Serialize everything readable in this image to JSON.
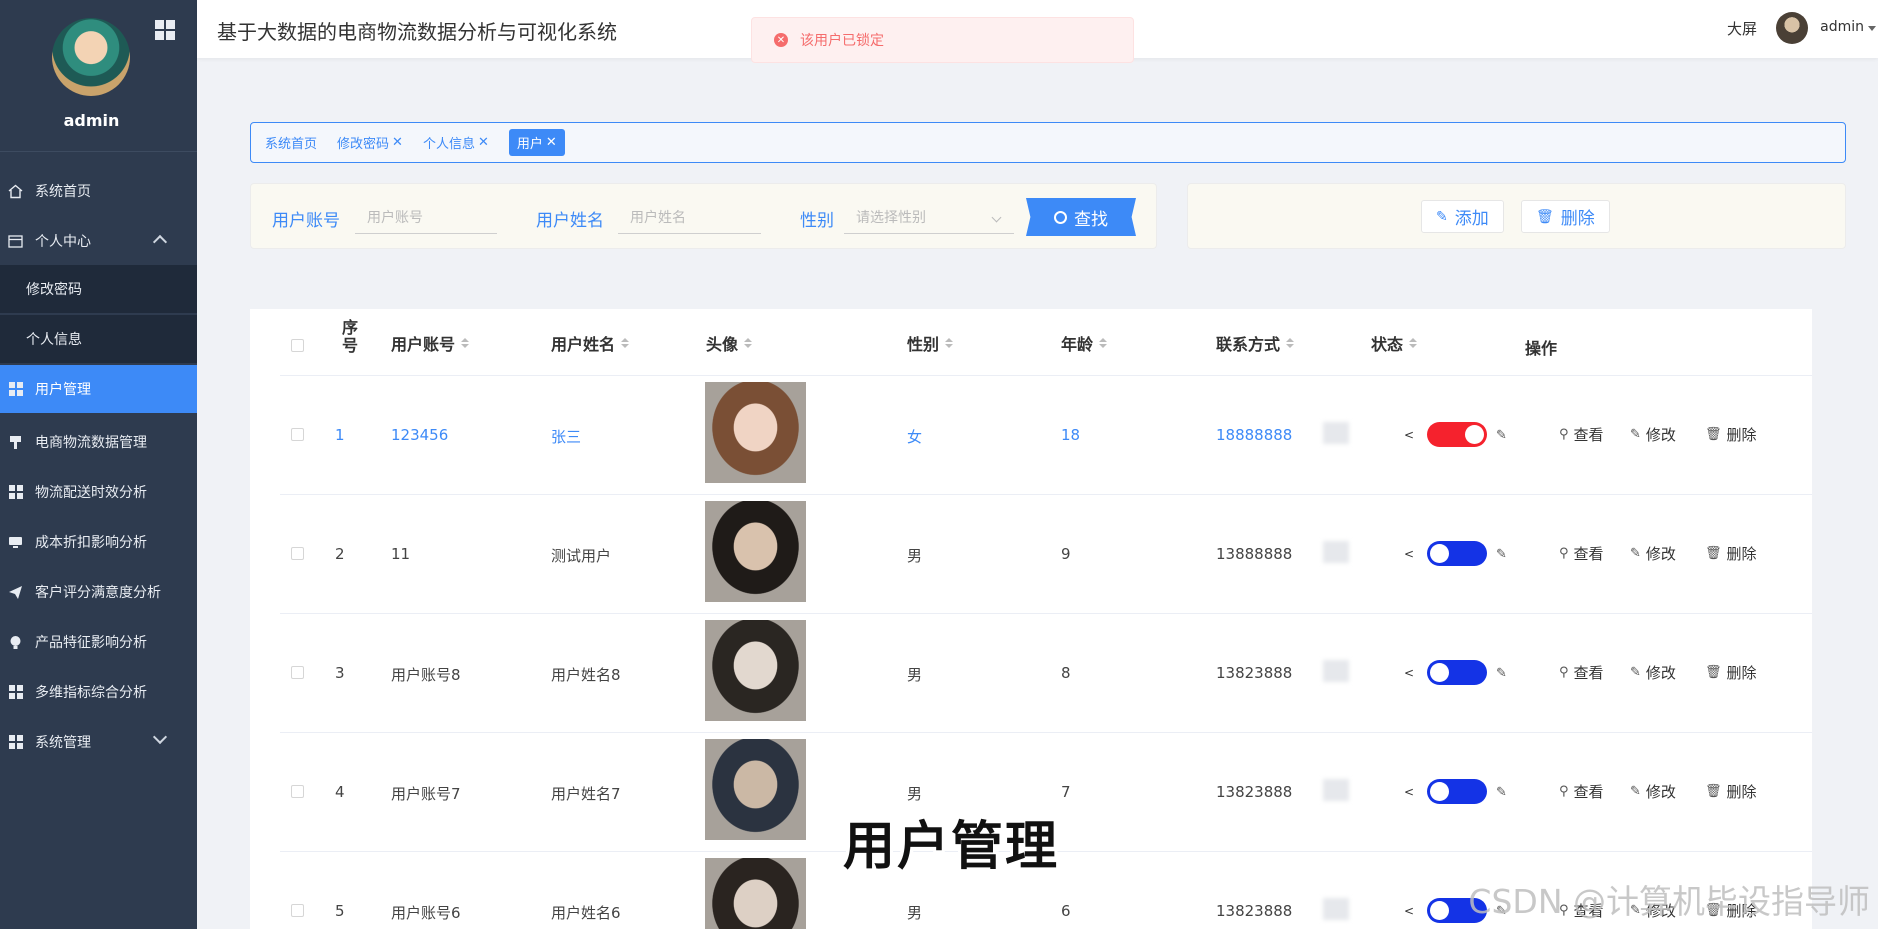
{
  "app": {
    "title": "基于大数据的电商物流数据分析与可视化系统",
    "big_screen": "大屏",
    "username": "admin"
  },
  "sidebar": {
    "username": "admin",
    "items": [
      {
        "label": "系统首页",
        "icon": "home-icon"
      },
      {
        "label": "个人中心",
        "icon": "profile-icon",
        "expanded": true
      },
      {
        "label": "修改密码",
        "sub": true
      },
      {
        "label": "个人信息",
        "sub": true
      },
      {
        "label": "用户管理",
        "icon": "grid-icon",
        "active": true
      },
      {
        "label": "电商物流数据管理",
        "icon": "brush-icon"
      },
      {
        "label": "物流配送时效分析",
        "icon": "grid-icon"
      },
      {
        "label": "成本折扣影响分析",
        "icon": "monitor-icon"
      },
      {
        "label": "客户评分满意度分析",
        "icon": "send-icon"
      },
      {
        "label": "产品特征影响分析",
        "icon": "bulb-icon"
      },
      {
        "label": "多维指标综合分析",
        "icon": "grid-icon"
      },
      {
        "label": "系统管理",
        "icon": "grid-icon",
        "expanded": false
      }
    ]
  },
  "toast": {
    "message": "该用户已锁定"
  },
  "tags": [
    {
      "label": "系统首页",
      "closable": false
    },
    {
      "label": "修改密码",
      "closable": true
    },
    {
      "label": "个人信息",
      "closable": true
    },
    {
      "label": "用户",
      "closable": true,
      "active": true
    }
  ],
  "search": {
    "account_label": "用户账号",
    "account_placeholder": "用户账号",
    "name_label": "用户姓名",
    "name_placeholder": "用户姓名",
    "gender_label": "性别",
    "gender_placeholder": "请选择性别",
    "button": "查找"
  },
  "actions": {
    "add": "添加",
    "delete": "删除"
  },
  "table": {
    "headers": [
      "序号",
      "用户账号",
      "用户姓名",
      "头像",
      "性别",
      "年龄",
      "联系方式",
      "状态",
      "操作"
    ],
    "ops": {
      "view": "查看",
      "edit": "修改",
      "delete": "删除"
    },
    "rows": [
      {
        "index": "1",
        "account": "123456",
        "name": "张三",
        "gender": "女",
        "age": "18",
        "phone": "18888888",
        "locked": true
      },
      {
        "index": "2",
        "account": "11",
        "name": "测试用户",
        "gender": "男",
        "age": "9",
        "phone": "13888888",
        "locked": false
      },
      {
        "index": "3",
        "account": "用户账号8",
        "name": "用户姓名8",
        "gender": "男",
        "age": "8",
        "phone": "13823888",
        "locked": false
      },
      {
        "index": "4",
        "account": "用户账号7",
        "name": "用户姓名7",
        "gender": "男",
        "age": "7",
        "phone": "13823888",
        "locked": false
      },
      {
        "index": "5",
        "account": "用户账号6",
        "name": "用户姓名6",
        "gender": "男",
        "age": "6",
        "phone": "13823888",
        "locked": false
      }
    ]
  },
  "overlay": {
    "subtitle": "用户管理",
    "watermark": "CSDN @计算机毕设指导师"
  },
  "colors": {
    "primary": "#3d8af7",
    "sidebar": "#2e3b4f",
    "locked": "#f5222d",
    "unlocked": "#1433e6"
  }
}
